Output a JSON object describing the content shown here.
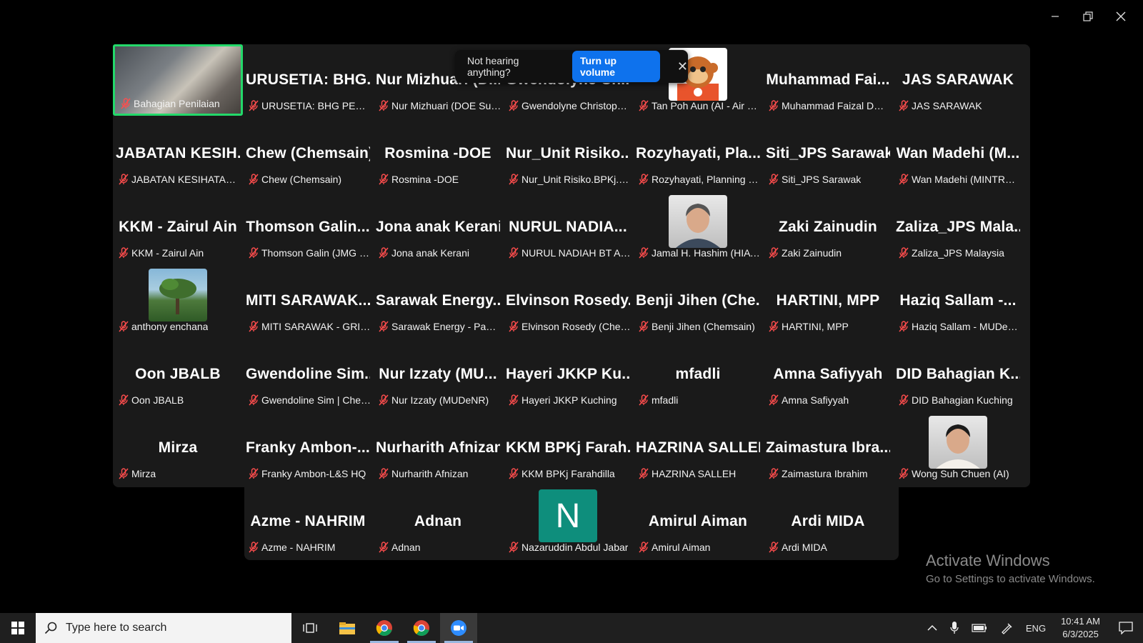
{
  "window": {
    "minimize": "minimize",
    "restore": "restore",
    "close": "close"
  },
  "toast": {
    "message": "Not hearing anything?",
    "button": "Turn up volume"
  },
  "participants": [
    {
      "big": "",
      "caption": "Bahagian Penilaian",
      "media": "video",
      "active": true
    },
    {
      "big": "URUSETIA: BHG...",
      "caption": "URUSETIA: BHG PENILAIA..."
    },
    {
      "big": "Nur Mizhuari (D...",
      "caption": "Nur Mizhuari (DOE Sung..."
    },
    {
      "big": "Gwendolyne Ch...",
      "caption": "Gwendolyne Christopher ..."
    },
    {
      "big": "",
      "caption": "Tan Poh Aun (AI - Air Qual...",
      "media": "cartoon"
    },
    {
      "big": "Muhammad Fai...",
      "caption": "Muhammad Faizal DOSH"
    },
    {
      "big": "JAS SARAWAK",
      "caption": "JAS SARAWAK"
    },
    {
      "big": "JABATAN KESIH...",
      "caption": "JABATAN KESIHATAN NE..."
    },
    {
      "big": "Chew (Chemsain)",
      "caption": "Chew (Chemsain)"
    },
    {
      "big": "Rosmina -DOE",
      "caption": "Rosmina -DOE"
    },
    {
      "big": "Nur_Unit Risiko....",
      "caption": "Nur_Unit Risiko.BPKj.KKM"
    },
    {
      "big": "Rozyhayati, Pla...",
      "caption": "Rozyhayati, Planning JTS-..."
    },
    {
      "big": "Siti_JPS Sarawak",
      "caption": "Siti_JPS Sarawak"
    },
    {
      "big": "Wan Madehi (M...",
      "caption": "Wan Madehi (MINTRED S..."
    },
    {
      "big": "KKM - Zairul Ain",
      "caption": "KKM - Zairul Ain"
    },
    {
      "big": "Thomson Galin...",
      "caption": "Thomson Galin (JMG SWK)"
    },
    {
      "big": "Jona anak Kerani",
      "caption": "Jona anak Kerani"
    },
    {
      "big": "NURUL NADIA...",
      "caption": "NURUL NADIAH BT AHM..."
    },
    {
      "big": "",
      "caption": "Jamal H. Hashim (HIA Co...",
      "media": "photo-man"
    },
    {
      "big": "Zaki Zainudin",
      "caption": "Zaki Zainudin"
    },
    {
      "big": "Zaliza_JPS Mala...",
      "caption": "Zaliza_JPS Malaysia"
    },
    {
      "big": "",
      "caption": "anthony enchana",
      "media": "landscape"
    },
    {
      "big": "MITI SARAWAK...",
      "caption": "MITI SARAWAK - GRIFFITH"
    },
    {
      "big": "Sarawak Energy...",
      "caption": "Sarawak Energy - Pang C..."
    },
    {
      "big": "Elvinson Rosedy...",
      "caption": "Elvinson Rosedy (Chemsa..."
    },
    {
      "big": "Benji Jihen (Che...",
      "caption": "Benji Jihen (Chemsain)"
    },
    {
      "big": "HARTINI, MPP",
      "caption": "HARTINI, MPP"
    },
    {
      "big": "Haziq Sallam -...",
      "caption": "Haziq Sallam - MUDeNR"
    },
    {
      "big": "Oon JBALB",
      "caption": "Oon JBALB"
    },
    {
      "big": "Gwendoline Sim...",
      "caption": "Gwendoline Sim | Chems..."
    },
    {
      "big": "Nur Izzaty (MU...",
      "caption": "Nur Izzaty (MUDeNR)"
    },
    {
      "big": "Hayeri JKKP Ku...",
      "caption": "Hayeri JKKP Kuching"
    },
    {
      "big": "mfadli",
      "caption": "mfadli"
    },
    {
      "big": "Amna Safiyyah",
      "caption": "Amna Safiyyah"
    },
    {
      "big": "DID Bahagian K...",
      "caption": "DID Bahagian Kuching"
    },
    {
      "big": "Mirza",
      "caption": "Mirza"
    },
    {
      "big": "Franky Ambon-...",
      "caption": "Franky Ambon-L&S HQ"
    },
    {
      "big": "Nurharith Afnizan",
      "caption": "Nurharith Afnizan"
    },
    {
      "big": "KKM BPKj Farah...",
      "caption": "KKM BPKj Farahdilla"
    },
    {
      "big": "HAZRINA SALLEH",
      "caption": "HAZRINA SALLEH"
    },
    {
      "big": "Zaimastura Ibra...",
      "caption": "Zaimastura Ibrahim"
    },
    {
      "big": "",
      "caption": "Wong Suh Chuen (AI)",
      "media": "photo-woman"
    },
    {
      "big": "Azme - NAHRIM",
      "caption": "Azme - NAHRIM"
    },
    {
      "big": "Adnan",
      "caption": "Adnan"
    },
    {
      "big": "",
      "caption": "Nazaruddin Abdul Jabar",
      "media": "letter",
      "letter": "N"
    },
    {
      "big": "Amirul Aiman",
      "caption": "Amirul Aiman"
    },
    {
      "big": "Ardi MIDA",
      "caption": "Ardi MIDA"
    }
  ],
  "watermark": {
    "title": "Activate Windows",
    "subtitle": "Go to Settings to activate Windows."
  },
  "taskbar": {
    "search_placeholder": "Type here to search",
    "apps": [
      "task-view",
      "file-explorer",
      "chrome",
      "chrome-profile",
      "zoom"
    ],
    "tray": {
      "language": "ENG",
      "time": "10:41 AM",
      "date": "6/3/2025"
    }
  },
  "colors": {
    "active_speaker": "#23d96a",
    "toast_button": "#0e72ed",
    "letter_avatar": "#0e8e7c",
    "taskbar": "#1f1f1f"
  }
}
